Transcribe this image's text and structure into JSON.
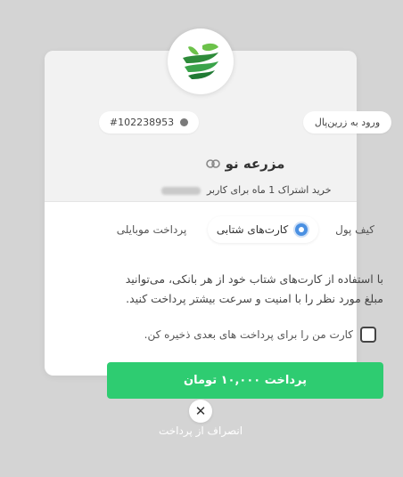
{
  "merchant": {
    "name": "مزرعه نو",
    "logo_icon": "leaf-logo-icon",
    "link_icon": "link-icon"
  },
  "header": {
    "login_label": "ورود به زرین‌پال",
    "transaction_id": "#102238953"
  },
  "description": {
    "before": "خرید اشتراک 1 ماه برای کاربر",
    "after": ""
  },
  "tabs": [
    {
      "label": "کیف پول",
      "selected": false
    },
    {
      "label": "کارت‌های شتابی",
      "selected": true
    },
    {
      "label": "پرداخت موبایلی",
      "selected": false
    }
  ],
  "info": {
    "line1": "با استفاده از کارت‌های شتاب خود از هر بانکی، می‌توانید",
    "line2": "مبلغ مورد نظر را با امنیت و سرعت بیشتر پرداخت کنید."
  },
  "save_card": {
    "label": "کارت من را برای پرداخت های بعدی ذخیره کن.",
    "checked": false
  },
  "pay_button": {
    "label": "پرداخت ۱۰,۰۰۰ تومان"
  },
  "cancel": {
    "label": "انصراف از پرداخت"
  },
  "colors": {
    "accent": "#2ecc71",
    "radio": "#4a90e2",
    "backdrop": "#d4d4d4"
  }
}
